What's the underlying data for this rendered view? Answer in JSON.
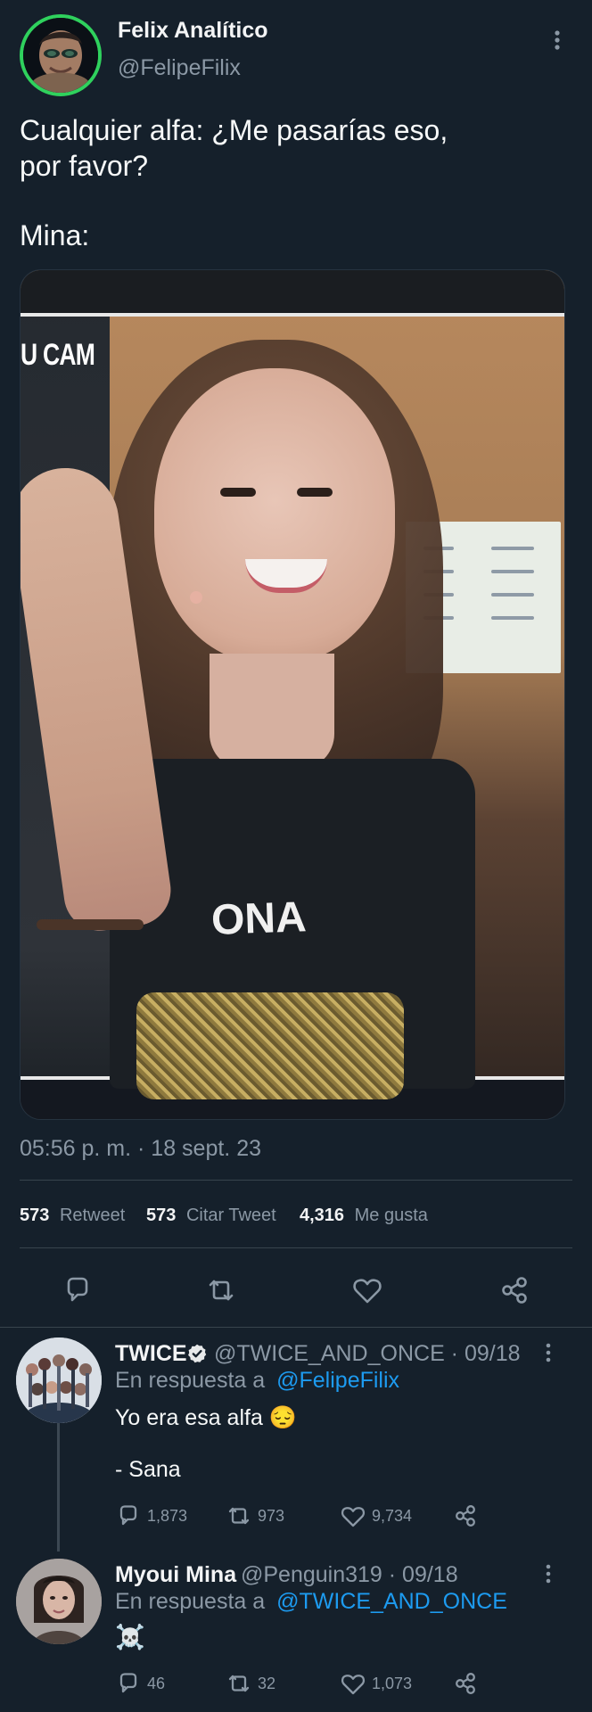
{
  "post": {
    "author_name": "Felix Analítico",
    "author_handle": "@FelipeFilix",
    "text_line1": "Cualquier alfa: ¿Me pasarías eso,",
    "text_line2": "por favor?",
    "text_line3": "Mina:",
    "timestamp": "05:56 p. m. · 18 sept. 23",
    "stats": {
      "retweets_count": "573",
      "retweets_label": "Retweet",
      "quotes_count": "573",
      "quotes_label": "Citar Tweet",
      "likes_count": "4,316",
      "likes_label": "Me gusta"
    },
    "media": {
      "overlay_text": "U CAM",
      "shirt_text": "ONA"
    }
  },
  "replies": [
    {
      "author_name": "TWICE",
      "handle_date": "@TWICE_AND_ONCE · 09/18",
      "reply_prefix": "En respuesta a",
      "reply_to": "@FelipeFilix",
      "text_line1": "Yo era esa alfa 😔",
      "text_line2": "- Sana",
      "reply_count": "1,873",
      "retweet_count": "973",
      "like_count": "9,734"
    },
    {
      "author_name": "Myoui Mina",
      "handle_date": "@Penguin319 · 09/18",
      "reply_prefix": "En respuesta a",
      "reply_to": "@TWICE_AND_ONCE",
      "text_line1": "☠️",
      "reply_count": "46",
      "retweet_count": "32",
      "like_count": "1,073"
    }
  ],
  "icons": {
    "menu": "more-vertical-icon",
    "reply": "reply-icon",
    "retweet": "retweet-icon",
    "like": "heart-icon",
    "share": "share-icon",
    "verified": "verified-badge-icon"
  },
  "colors": {
    "background": "#15202b",
    "text": "#e7e9ea",
    "muted": "#8b98a5",
    "link": "#1d9bf0",
    "divider": "#38444d"
  }
}
